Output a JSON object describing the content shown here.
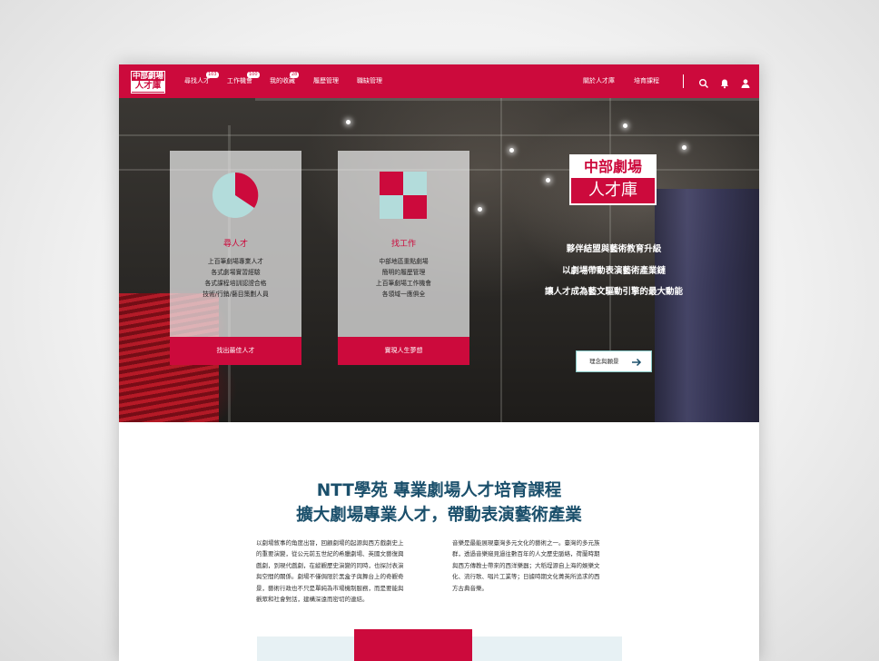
{
  "nav": {
    "logo_line1": "中部劇場",
    "logo_line2": "人才庫",
    "items": [
      {
        "label": "尋找人才",
        "badge": "103"
      },
      {
        "label": "工作機會",
        "badge": "100"
      },
      {
        "label": "我的收藏",
        "badge": "28"
      },
      {
        "label": "履歷管理",
        "badge": ""
      },
      {
        "label": "職缺管理",
        "badge": ""
      }
    ],
    "right_items": [
      "關於人才庫",
      "培育課程"
    ],
    "icons": [
      "search-icon",
      "bell-icon",
      "user-icon"
    ]
  },
  "hero": {
    "cards": [
      {
        "title": "尋人才",
        "lines": [
          "上百筆劇場專業人才",
          "各式劇場實習經驗",
          "各式課程培訓認證合格",
          "技術/行銷/藝目策劃人員"
        ],
        "button": "找出最佳人才",
        "icon": "pie-icon"
      },
      {
        "title": "找工作",
        "lines": [
          "中部地區重點劇場",
          "簡明的履歷管理",
          "上百筆劇場工作機會",
          "各領域一應俱全"
        ],
        "button": "實現人生夢想",
        "icon": "grid-icon"
      }
    ],
    "logo_line1": "中部劇場",
    "logo_line2": "人才庫",
    "taglines": [
      "夥伴結盟與藝術教育升級",
      "以劇場帶動表演藝術產業鏈",
      "讓人才成為藝文驅動引擎的最大動能"
    ],
    "cta_label": "理念與願景"
  },
  "content": {
    "heading_line1": "NTT學苑 專業劇場人才培育課程",
    "heading_line2": "擴大劇場專業人才，帶動表演藝術產業",
    "left_para": [
      "以劇場敘事的角度出發，回顧劇場的起源與西方戲劇史上",
      "的重要演變，從公元前五世紀的希臘劇場、英國文藝復興",
      "戲劇，到現代戲劇，在縱觀歷史演變的同時，也探討表演",
      "與空間的關係。劇場不僅侷限於黑盒子與舞台上的奇觀奇",
      "景，藝術行政也不只是單純為市場機制服務，而是要能與",
      "觀眾和社會對話，建構深遠而密切的連結。"
    ],
    "right_para": [
      "音樂是最能展現臺灣多元文化的藝術之一。臺灣的多元族",
      "群，透過音樂窺見過往數百年的人文歷史脈絡，荷蘭時期",
      "與西方傳教士帶來的西洋樂器；大稻埕源自上海的娛樂文",
      "化、流行歌、唱片工業等；日據時期文化菁英所追求的西",
      "方古典音樂。"
    ]
  },
  "colors": {
    "brand_red": "#cc0a3c",
    "heading_blue": "#1a4f6b",
    "accent_teal": "#b3dcdb"
  }
}
